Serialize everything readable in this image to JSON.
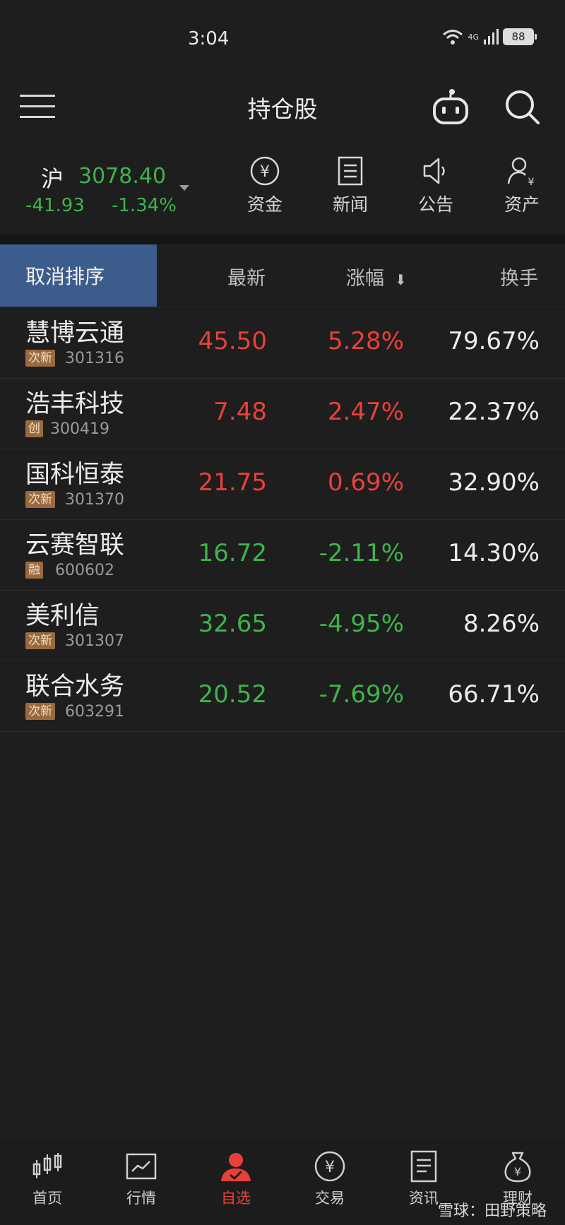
{
  "status_bar": {
    "time": "3:04",
    "network": "4G",
    "battery": "88"
  },
  "header": {
    "title": "持仓股"
  },
  "index": {
    "name": "沪",
    "value": "3078.40",
    "change": "-41.93",
    "change_pct": "-1.34%"
  },
  "quick_links": [
    {
      "label": "资金",
      "icon": "yuan-circle-icon"
    },
    {
      "label": "新闻",
      "icon": "news-doc-icon"
    },
    {
      "label": "公告",
      "icon": "speaker-icon"
    },
    {
      "label": "资产",
      "icon": "user-asset-icon"
    }
  ],
  "table": {
    "cancel_sort": "取消排序",
    "columns": {
      "latest": "最新",
      "change": "涨幅",
      "turnover": "换手"
    },
    "rows": [
      {
        "name": "慧博云通",
        "tag": "次新",
        "code": "301316",
        "price": "45.50",
        "change": "5.28%",
        "turnover": "79.67%",
        "trend": "up"
      },
      {
        "name": "浩丰科技",
        "tag": "创",
        "code": "300419",
        "price": "7.48",
        "change": "2.47%",
        "turnover": "22.37%",
        "trend": "up"
      },
      {
        "name": "国科恒泰",
        "tag": "次新",
        "code": "301370",
        "price": "21.75",
        "change": "0.69%",
        "turnover": "32.90%",
        "trend": "up"
      },
      {
        "name": "云赛智联",
        "tag": "融",
        "code": "600602",
        "price": "16.72",
        "change": "-2.11%",
        "turnover": "14.30%",
        "trend": "down"
      },
      {
        "name": "美利信",
        "tag": "次新",
        "code": "301307",
        "price": "32.65",
        "change": "-4.95%",
        "turnover": "8.26%",
        "trend": "down"
      },
      {
        "name": "联合水务",
        "tag": "次新",
        "code": "603291",
        "price": "20.52",
        "change": "-7.69%",
        "turnover": "66.71%",
        "trend": "down"
      }
    ]
  },
  "tabs": [
    {
      "label": "首页",
      "icon": "candlestick-icon"
    },
    {
      "label": "行情",
      "icon": "chart-icon"
    },
    {
      "label": "自选",
      "icon": "user-check-icon",
      "active": true
    },
    {
      "label": "交易",
      "icon": "yuan-circle-icon"
    },
    {
      "label": "资讯",
      "icon": "document-icon"
    },
    {
      "label": "理财",
      "icon": "money-bag-icon"
    }
  ],
  "watermark": "雪球：田野策略",
  "colors": {
    "up": "#e8413a",
    "down": "#3db54a",
    "highlight": "#3c5c8c",
    "tag": "#9a6a3e"
  }
}
